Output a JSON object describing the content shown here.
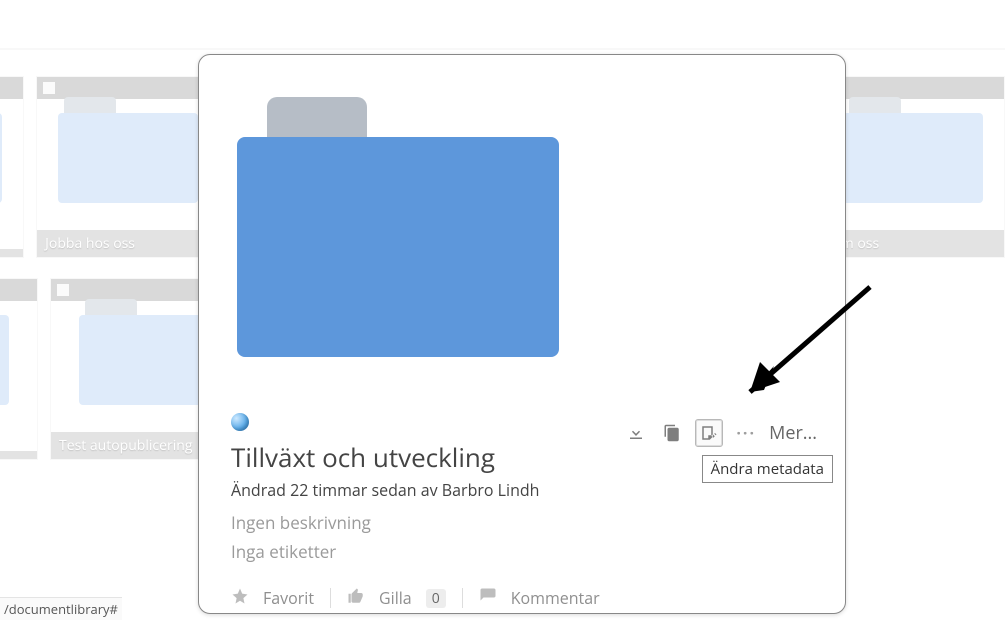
{
  "cards": {
    "row1": [
      {
        "label": ""
      },
      {
        "label": "Jobba hos oss"
      },
      {
        "label": ""
      },
      {
        "label": ""
      },
      {
        "label": ""
      },
      {
        "label": "Om oss"
      }
    ],
    "row2": [
      {
        "label": ""
      },
      {
        "label": "Test autopublicering"
      }
    ]
  },
  "modal": {
    "title": "Tillväxt och utveckling",
    "modified": "Ändrad 22 timmar sedan av Barbro Lindh",
    "description": "Ingen beskrivning",
    "tags": "Inga etiketter",
    "favorite": "Favorit",
    "like": "Gilla",
    "like_count": "0",
    "comment": "Kommentar",
    "more": "Mer...",
    "tooltip": "Ändra metadata"
  },
  "status": "/documentlibrary#"
}
